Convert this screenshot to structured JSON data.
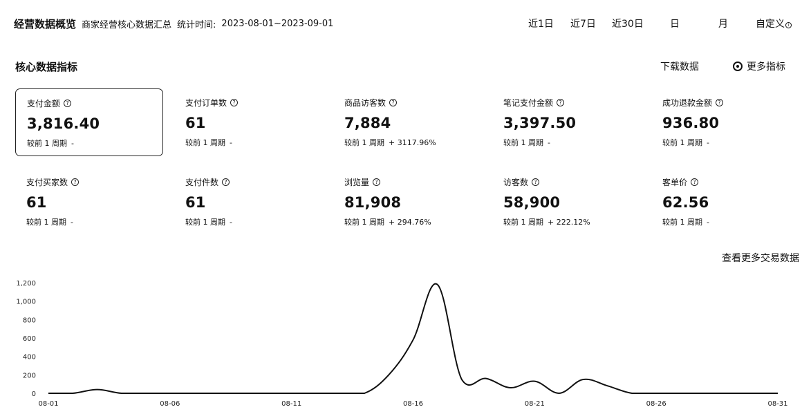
{
  "header": {
    "title": "经营数据概览",
    "subtitle": "商家经营核心数据汇总",
    "period_label": "统计时间:",
    "period_range": "2023-08-01~2023-09-01"
  },
  "range_tabs": [
    {
      "label": "近1日"
    },
    {
      "label": "近7日"
    },
    {
      "label": "近30日"
    },
    {
      "label": "日"
    },
    {
      "label": "月"
    },
    {
      "label": "自定义"
    }
  ],
  "section": {
    "title": "核心数据指标",
    "download_label": "下载数据",
    "more_metrics_label": "更多指标",
    "more_trade_label": "查看更多交易数据"
  },
  "compare_prefix": "较前 1 周期",
  "metrics": [
    {
      "label": "支付金额",
      "value": "3,816.40",
      "delta": "-"
    },
    {
      "label": "支付订单数",
      "value": "61",
      "delta": "-"
    },
    {
      "label": "商品访客数",
      "value": "7,884",
      "delta": "+ 3117.96%"
    },
    {
      "label": "笔记支付金额",
      "value": "3,397.50",
      "delta": "-"
    },
    {
      "label": "成功退款金额",
      "value": "936.80",
      "delta": "-"
    },
    {
      "label": "支付买家数",
      "value": "61",
      "delta": "-"
    },
    {
      "label": "支付件数",
      "value": "61",
      "delta": "-"
    },
    {
      "label": "浏览量",
      "value": "81,908",
      "delta": "+ 294.76%"
    },
    {
      "label": "访客数",
      "value": "58,900",
      "delta": "+ 222.12%"
    },
    {
      "label": "客单价",
      "value": "62.56",
      "delta": "-"
    }
  ],
  "chart_data": {
    "type": "line",
    "x": [
      "08-01",
      "08-02",
      "08-03",
      "08-04",
      "08-05",
      "08-06",
      "08-07",
      "08-08",
      "08-09",
      "08-10",
      "08-11",
      "08-12",
      "08-13",
      "08-14",
      "08-15",
      "08-16",
      "08-17",
      "08-18",
      "08-19",
      "08-20",
      "08-21",
      "08-22",
      "08-23",
      "08-24",
      "08-25",
      "08-26",
      "08-27",
      "08-28",
      "08-29",
      "08-30",
      "08-31"
    ],
    "x_tick_labels": [
      "08-01",
      "08-06",
      "08-11",
      "08-16",
      "08-21",
      "08-26",
      "08-31"
    ],
    "series": [
      {
        "values": [
          0,
          0,
          40,
          0,
          0,
          0,
          0,
          0,
          0,
          0,
          0,
          0,
          0,
          0,
          200,
          580,
          1180,
          150,
          160,
          60,
          130,
          0,
          150,
          80,
          0,
          0,
          0,
          0,
          0,
          0,
          0
        ]
      }
    ],
    "ylim": [
      0,
      1200
    ],
    "y_ticks": [
      0,
      200,
      400,
      600,
      800,
      1000,
      1200
    ],
    "y_tick_labels": [
      "0",
      "200",
      "400",
      "600",
      "800",
      "1,000",
      "1,200"
    ],
    "grid": false,
    "line_color": "#111111"
  }
}
